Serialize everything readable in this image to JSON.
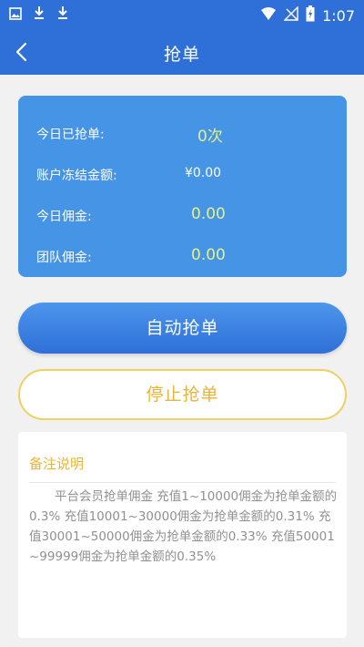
{
  "status_bar": {
    "time": "1:07",
    "left_icons": [
      "image-icon",
      "download-icon",
      "download-icon"
    ],
    "right_icons": [
      "wifi-icon",
      "no-signal-icon",
      "battery-charging-icon"
    ]
  },
  "header": {
    "title": "抢单"
  },
  "stats": [
    {
      "label": "今日已抢单:",
      "value": "0次"
    },
    {
      "label": "账户冻结金额:",
      "value": "¥0.00"
    },
    {
      "label": "今日佣金:",
      "value": "0.00"
    },
    {
      "label": "团队佣金:",
      "value": "0.00"
    }
  ],
  "buttons": {
    "auto_label": "自动抢单",
    "stop_label": "停止抢单"
  },
  "notes": {
    "title": "备注说明",
    "body": "平台会员抢单佣金 充值1~10000佣金为抢单金额的0.3% 充值10001~30000佣金为抢单金额的0.31% 充值30001~50000佣金为抢单金额的0.33% 充值50001~99999佣金为抢单金额的0.35%"
  },
  "colors": {
    "primary": "#2f6fd8",
    "card": "#4594e5",
    "value_highlight": "#e4f08a",
    "accent_gold": "#e8b43b"
  }
}
